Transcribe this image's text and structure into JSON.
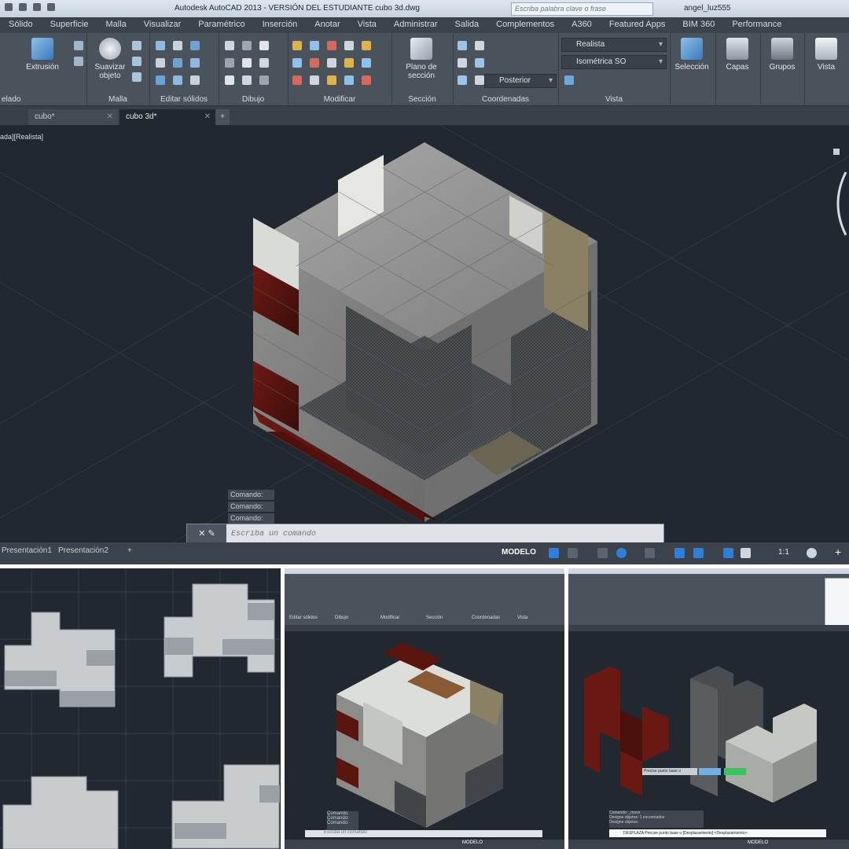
{
  "titlebar": {
    "title": "Autodesk AutoCAD 2013 - VERSIÓN DEL ESTUDIANTE    cubo 3d.dwg",
    "search_placeholder": "Escriba palabra clave o frase",
    "user": "angel_luz555"
  },
  "menu": [
    "Sólido",
    "Superficie",
    "Malla",
    "Visualizar",
    "Paramétrico",
    "Inserción",
    "Anotar",
    "Vista",
    "Administrar",
    "Salida",
    "Complementos",
    "A360",
    "Featured Apps",
    "BIM 360",
    "Performance"
  ],
  "ribbon": {
    "btn_extrusion": "Extrusión",
    "btn_suavizar": "Suavizar objeto",
    "btn_plano": "Plano de sección",
    "btn_seleccion": "Selección",
    "btn_capas": "Capas",
    "btn_grupos": "Grupos",
    "btn_vista": "Vista",
    "drop_visual": "Realista",
    "drop_view": "Isométrica SO",
    "drop_ucs": "Posterior",
    "groups": {
      "modelado": "elado",
      "malla": "Malla",
      "editar": "Editar sólidos",
      "dibujo": "Dibujo",
      "modificar": "Modificar",
      "seccion": "Sección",
      "coordenadas": "Coordenadas",
      "vistas": "Vista"
    }
  },
  "tabs": {
    "tab1": "cubo*",
    "tab2": "cubo 3d*"
  },
  "viewport": {
    "label": "ada][Realista]"
  },
  "command": {
    "history": [
      "Comando:",
      "Comando:",
      "Comando:"
    ],
    "placeholder": "Escriba un comando"
  },
  "status": {
    "layout1": "Presentación1",
    "layout2": "Presentación2",
    "model": "MODELO",
    "scale": "1:1"
  },
  "mini2": {
    "groups": [
      "Editar sólidos",
      "Dibujo",
      "Modificar",
      "Sección",
      "Coordenadas",
      "Vista"
    ],
    "cmd_placeholder": "Escriba un comando",
    "model": "MODELO"
  },
  "mini3": {
    "prompt": "Precise punto base o",
    "cmd": "DESPLAZA Precise punto base o [Desplazamiento] <Desplazamiento>:",
    "model": "MODELO"
  }
}
